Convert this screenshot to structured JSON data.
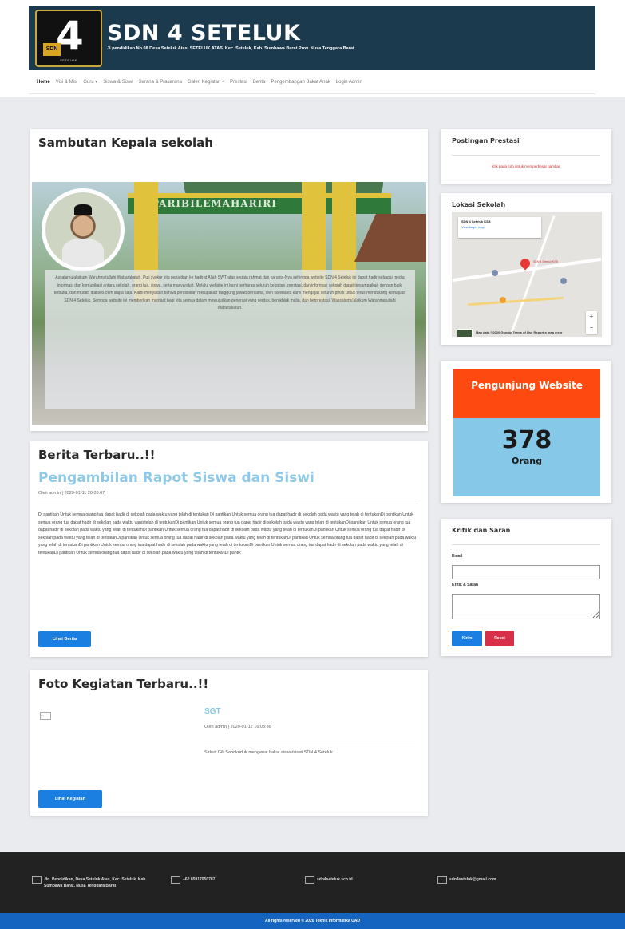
{
  "header": {
    "title": "SDN 4 SETELUK",
    "subtitle": "Jl.pendidikan No.08 Desa Seteluk Atas, SETELUK ATAS, Kec. Seteluk, Kab. Sumbawa Barat Prov. Nusa Tenggara Barat",
    "logo_number": "4",
    "logo_badge": "SDN",
    "logo_caption": "SETELUK"
  },
  "nav": {
    "items": [
      "Home",
      "Visi & Misi",
      "Guru ▾",
      "Siswa & Siswi",
      "Sarana & Prasarana",
      "Galeri Kegiatan ▾",
      "Prestasi",
      "Berita",
      "Pengembangan Bakat Anak",
      "Login Admin"
    ]
  },
  "sambutan": {
    "title": "Sambutan Kepala sekolah",
    "gate_text": "PARIBILEMAHARIRI",
    "text": "Assalamu'alaikum Warahmatullahi Wabarakatuh. Puji syukur kita panjatkan ke hadirat Allah SWT atas segala rahmat dan karunia-Nya sehingga website SDN 4 Seteluk ini dapat hadir sebagai media informasi dan komunikasi antara sekolah, orang tua, siswa, serta masyarakat. Melalui website ini kami berharap seluruh kegiatan, prestasi, dan informasi sekolah dapat tersampaikan dengan baik, terbuka, dan mudah diakses oleh siapa saja. Kami menyadari bahwa pendidikan merupakan tanggung jawab bersama, oleh karena itu kami mengajak seluruh pihak untuk terus mendukung kemajuan SDN 4 Seteluk. Semoga website ini memberikan manfaat bagi kita semua dalam mewujudkan generasi yang cerdas, berakhlak mulia, dan berprestasi. Wassalamu'alaikum Warahmatullahi Wabarakatuh."
  },
  "berita": {
    "title": "Berita Terbaru..!!",
    "post_title": "Pengambilan Rapot Siswa dan Siswi",
    "meta": "Oleh admin | 2020-01-11 20:06:07",
    "body": "Di pantikan Untuk semua orang tua dapat hadir di sekolah pada waktu yang telah di tentukan Di pantikan Untuk semua orang tua dapat hadir di sekolah pada waktu yang telah di tentukanDi pantikan Untuk semua orang tua dapat hadir di sekolah pada waktu yang telah di tentukanDi pantikan Untuk semua orang tua dapat hadir di sekolah pada waktu yang telah di tentukanDi pantikan Untuk semua orang tua dapat hadir di sekolah pada waktu yang telah di tentukanDi pantikan Untuk semua orang tua dapat hadir di sekolah pada waktu yang telah di tentukanDi pantikan Untuk semua orang tua dapat hadir di sekolah pada waktu yang telah di tentukanDi pantikan Untuk semua orang tua dapat hadir di sekolah pada waktu yang telah di tentukanDi pantikan Untuk semua orang tua dapat hadir di sekolah pada waktu yang telah di tentukanDi pantikan Untuk semua orang tua dapat hadir di sekolah pada waktu yang telah di tentukanDi pantikan Untuk semua orang tua dapat hadir di sekolah pada waktu yang telah di tentukanDi pantikan Untuk semua orang tua dapat hadir di sekolah pada waktu yang telah di tentukanDi pantik",
    "button": "Lihat Berita"
  },
  "foto": {
    "title": "Foto Kegiatan Terbaru..!!",
    "image_alt": "...",
    "kegiatan_title": "SGT",
    "meta": "Oleh admin | 2020-01-12 16:03:36",
    "desc": "Sirkuit Gili Sabokuduk mengenai bakat siswa/siswi SDN 4 Seteluk",
    "button": "Lihat Kegiatan"
  },
  "prestasi": {
    "title": "Postingan Prestasi",
    "note": "Klik pada foto untuk memperbesar gambar"
  },
  "lokasi": {
    "title": "Lokasi Sekolah",
    "info_title": "SDN 4 Seteluk KSB",
    "info_link": "View larger map",
    "pin_label": "SDN 4 Seteluk KSB",
    "footer": "Map data ©2020 Google  Terms of Use  Report a map error"
  },
  "pengunjung": {
    "title": "Pengunjung Website",
    "count": "378",
    "unit": "Orang"
  },
  "kritik": {
    "title": "Kritik dan Saran",
    "label_email": "Email",
    "label_kritik": "Kritik & Saran",
    "email_value": "",
    "kritik_value": "",
    "send": "Kirim",
    "reset": "Reset"
  },
  "footer": {
    "address": "Jln. Pendidikan, Desa Seteluk Atas, Kec. Seteluk, Kab. Sumbawa Barat, Nusa Tenggara Barat",
    "phone": "+62 85917050787",
    "website": "sdn4seteluk.sch.id",
    "email": "sdn4seteluk@gmail.com",
    "copyright": "All rights reserved © 2020 Teknik Informatika UAD"
  }
}
